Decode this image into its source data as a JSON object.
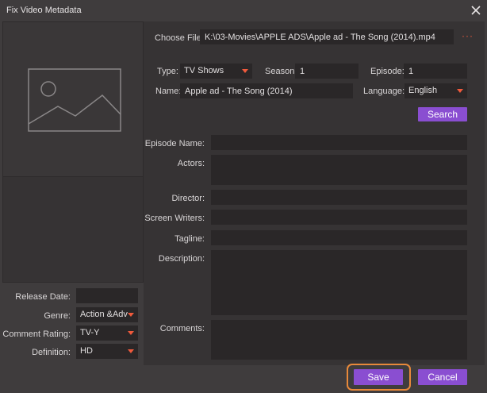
{
  "window": {
    "title": "Fix Video Metadata"
  },
  "file": {
    "label": "Choose File:",
    "path": "K:\\03-Movies\\APPLE ADS\\Apple ad - The Song (2014).mp4",
    "browse": "···"
  },
  "type": {
    "label": "Type:",
    "value": "TV Shows"
  },
  "season": {
    "label": "Season:",
    "value": "1"
  },
  "episode": {
    "label": "Episode:",
    "value": "1"
  },
  "name": {
    "label": "Name:",
    "value": "Apple ad - The Song (2014)"
  },
  "language": {
    "label": "Language:",
    "value": "English"
  },
  "search_button": "Search",
  "fields": {
    "episode_name": "Episode Name:",
    "actors": "Actors:",
    "director": "Director:",
    "screen_writers": "Screen Writers:",
    "tagline": "Tagline:",
    "description": "Description:",
    "comments": "Comments:"
  },
  "left": {
    "release_date": {
      "label": "Release Date:",
      "value": ""
    },
    "genre": {
      "label": "Genre:",
      "value": "Action &Adv"
    },
    "comment_rating": {
      "label": "Comment Rating:",
      "value": "TV-Y"
    },
    "definition": {
      "label": "Definition:",
      "value": "HD"
    }
  },
  "buttons": {
    "save": "Save",
    "cancel": "Cancel"
  },
  "colors": {
    "accent": "#8a4ed1",
    "arrow": "#f05a3c",
    "focus_ring": "#e8893a"
  },
  "icons": {
    "close": "close-icon",
    "thumbnail": "image-placeholder-icon",
    "dropdown": "chevron-down-icon"
  }
}
